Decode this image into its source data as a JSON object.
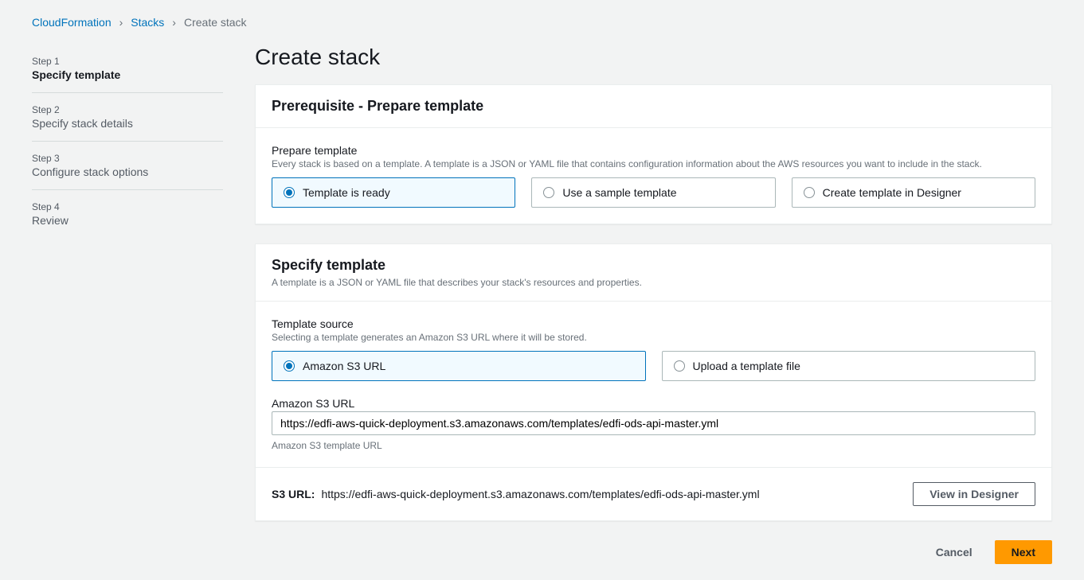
{
  "breadcrumb": {
    "items": [
      "CloudFormation",
      "Stacks"
    ],
    "current": "Create stack"
  },
  "sidebar": {
    "steps": [
      {
        "num": "Step 1",
        "title": "Specify template"
      },
      {
        "num": "Step 2",
        "title": "Specify stack details"
      },
      {
        "num": "Step 3",
        "title": "Configure stack options"
      },
      {
        "num": "Step 4",
        "title": "Review"
      }
    ]
  },
  "page": {
    "title": "Create stack"
  },
  "prereq": {
    "heading": "Prerequisite - Prepare template",
    "field_label": "Prepare template",
    "field_hint": "Every stack is based on a template. A template is a JSON or YAML file that contains configuration information about the AWS resources you want to include in the stack.",
    "options": [
      "Template is ready",
      "Use a sample template",
      "Create template in Designer"
    ]
  },
  "specify": {
    "heading": "Specify template",
    "subtitle": "A template is a JSON or YAML file that describes your stack's resources and properties.",
    "source_label": "Template source",
    "source_hint": "Selecting a template generates an Amazon S3 URL where it will be stored.",
    "source_options": [
      "Amazon S3 URL",
      "Upload a template file"
    ],
    "url_label": "Amazon S3 URL",
    "url_value": "https://edfi-aws-quick-deployment.s3.amazonaws.com/templates/edfi-ods-api-master.yml",
    "url_help": "Amazon S3 template URL",
    "s3_url_label": "S3 URL:",
    "s3_url_value": "https://edfi-aws-quick-deployment.s3.amazonaws.com/templates/edfi-ods-api-master.yml",
    "view_designer": "View in Designer"
  },
  "actions": {
    "cancel": "Cancel",
    "next": "Next"
  }
}
